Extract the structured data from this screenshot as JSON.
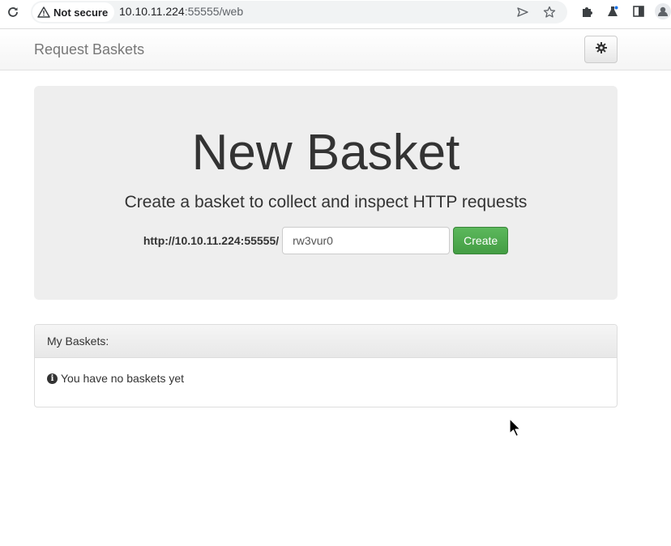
{
  "browser": {
    "security_label": "Not secure",
    "url_host": "10.10.11.224",
    "url_rest": ":55555/web"
  },
  "navbar": {
    "brand": "Request Baskets"
  },
  "jumbotron": {
    "title": "New Basket",
    "lead": "Create a basket to collect and inspect HTTP requests",
    "url_prefix": "http://10.10.11.224:55555/",
    "basket_name_value": "rw3vur0",
    "create_label": "Create"
  },
  "my_baskets": {
    "heading": "My Baskets:",
    "empty_message": "You have no baskets yet"
  },
  "colors": {
    "create_button": "#5cb85c",
    "jumbotron_bg": "#eeeeee",
    "brand_text": "#777777"
  }
}
